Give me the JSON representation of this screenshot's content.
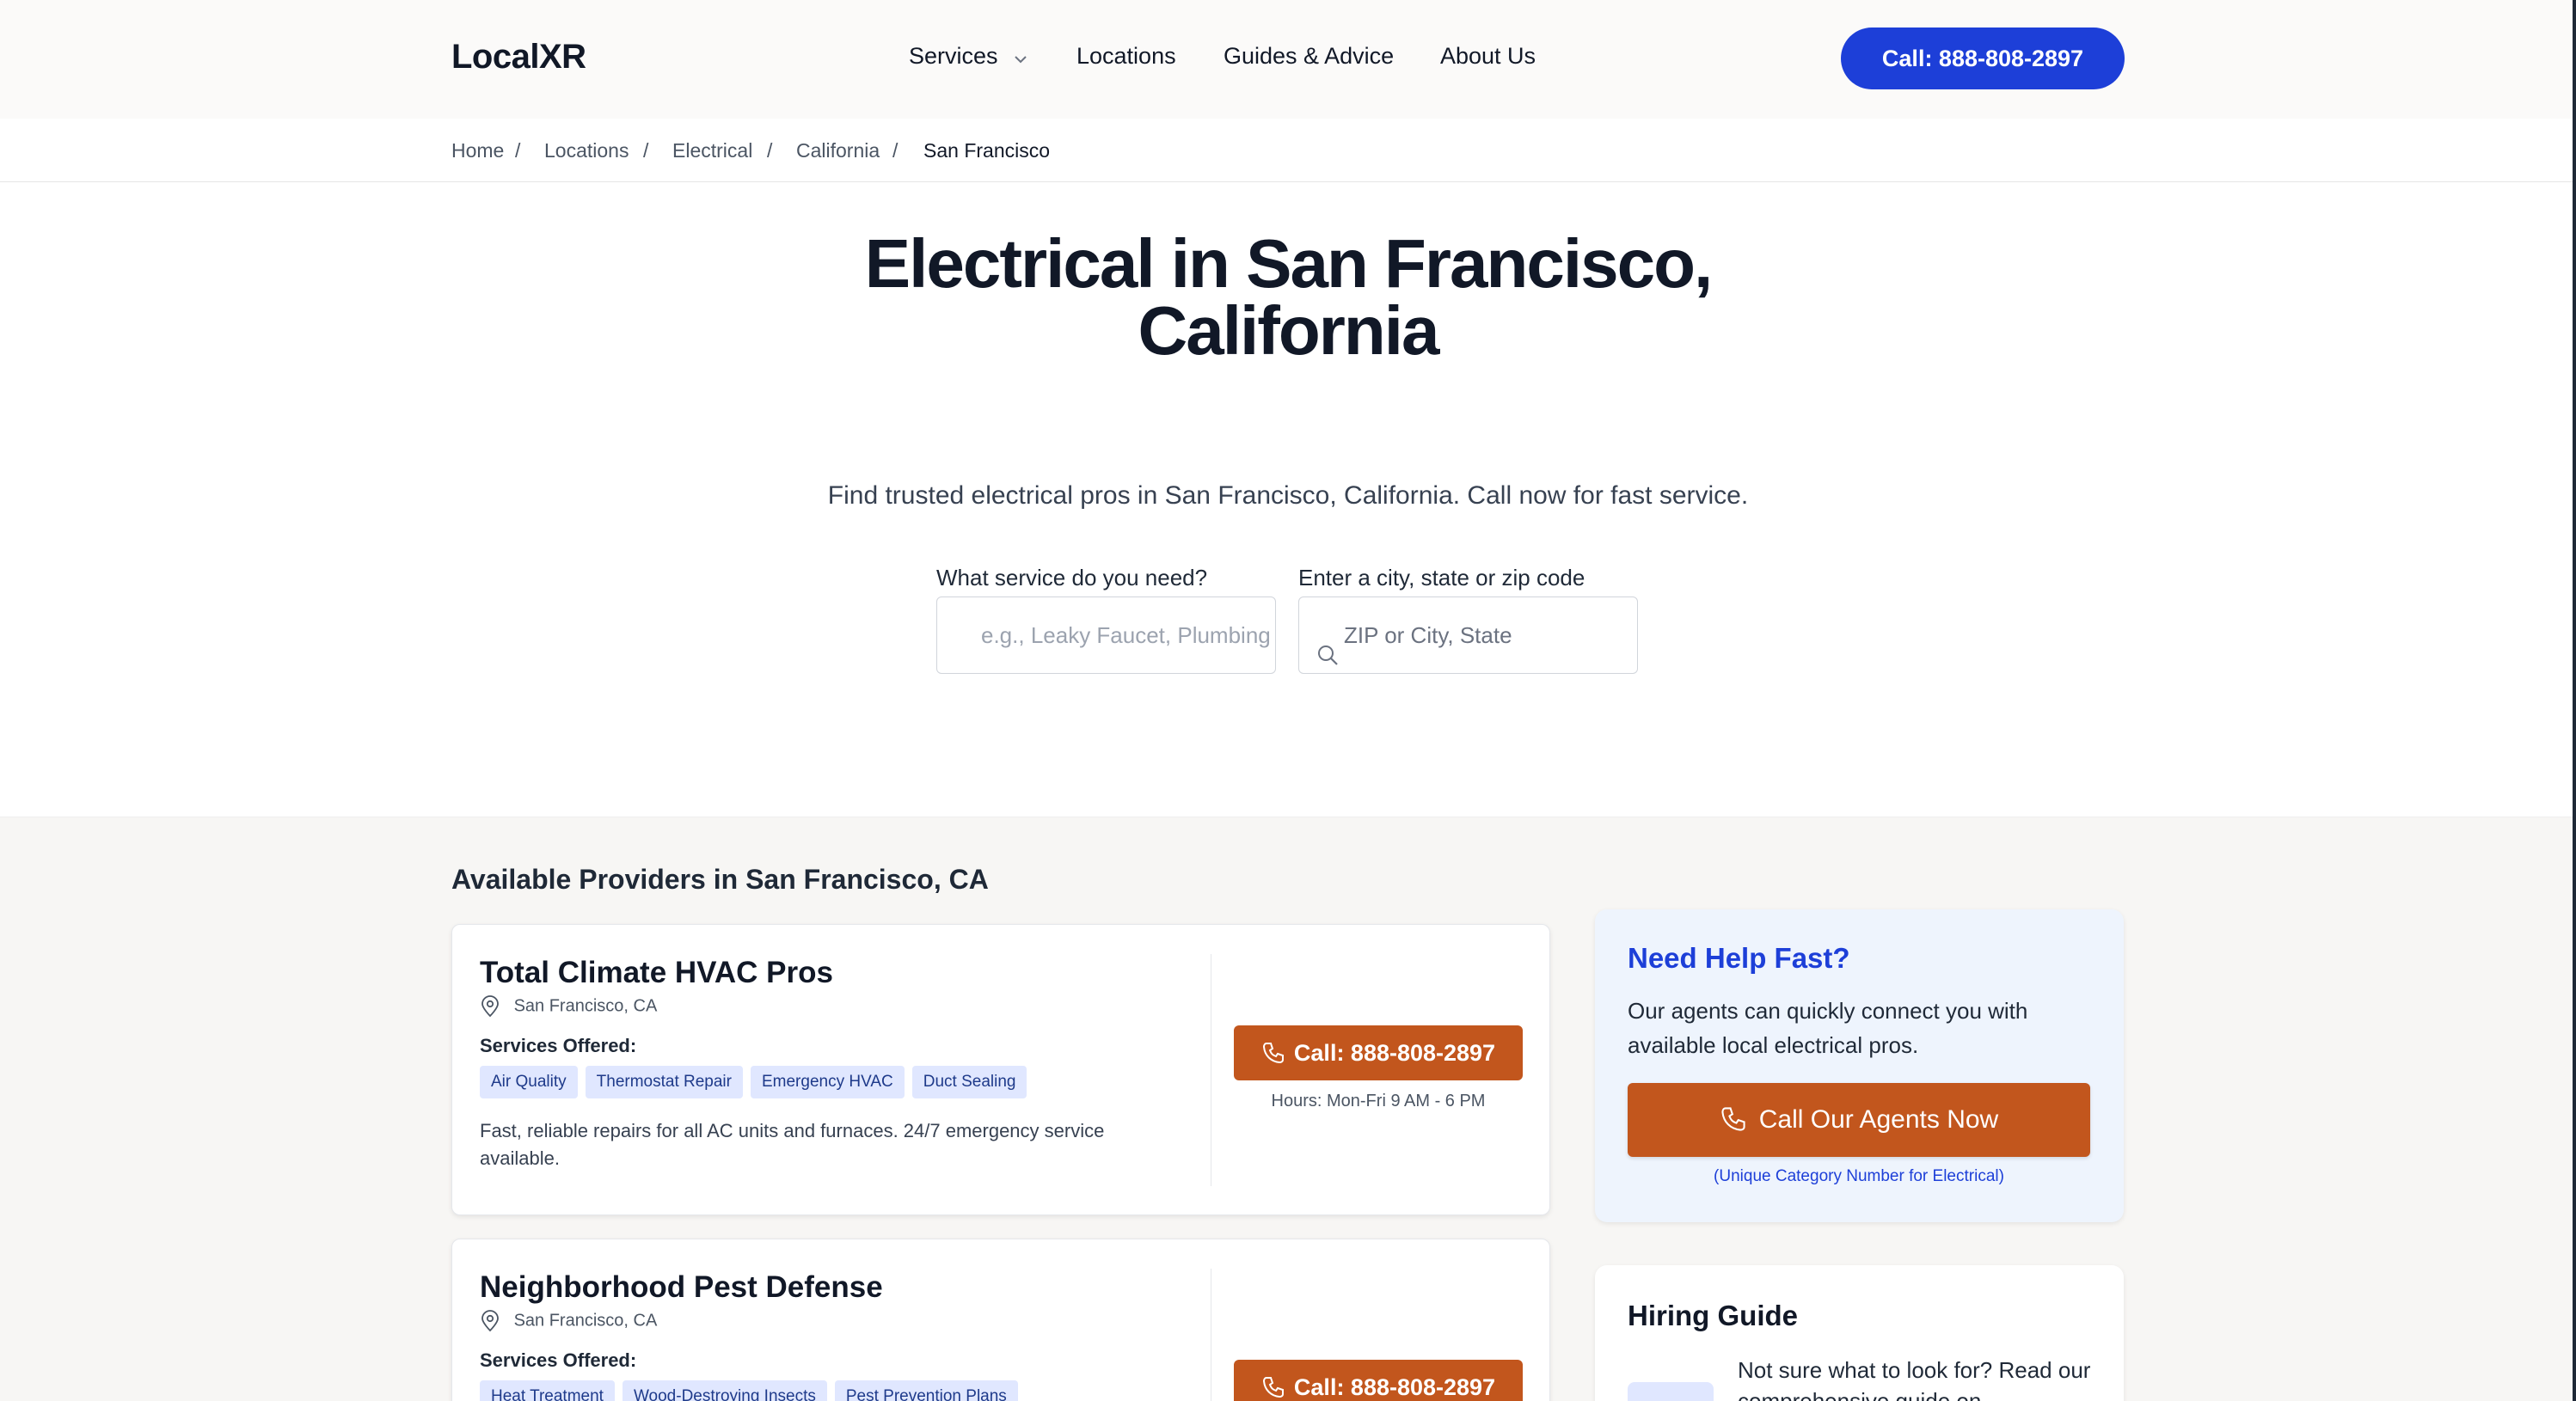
{
  "header": {
    "logo": "LocalXR",
    "nav": [
      {
        "label": "Services",
        "has_dropdown": true
      },
      {
        "label": "Locations"
      },
      {
        "label": "Guides & Advice"
      },
      {
        "label": "About Us"
      }
    ],
    "call_label": "Call: 888-808-2897"
  },
  "breadcrumb": {
    "items": [
      "Home",
      "Locations",
      "Electrical",
      "California"
    ],
    "separator": "/",
    "current": "San Francisco"
  },
  "hero": {
    "title_line1": "Electrical in San Francisco,",
    "title_line2": "California",
    "subtitle": "Find trusted electrical pros in San Francisco, California. Call now for fast service.",
    "service_label": "What service do you need?",
    "service_placeholder": "e.g., Leaky Faucet, Plumbing",
    "location_label": "Enter a city, state or zip code",
    "location_placeholder": "ZIP or City, State"
  },
  "providers": {
    "title": "Available Providers in San Francisco, CA",
    "services_offered_label": "Services Offered:",
    "items": [
      {
        "name": "Total Climate HVAC Pros",
        "location": "San Francisco, CA",
        "tags": [
          "Air Quality",
          "Thermostat Repair",
          "Emergency HVAC",
          "Duct Sealing"
        ],
        "description": "Fast, reliable repairs for all AC units and furnaces. 24/7 emergency service available.",
        "call_label": "Call: 888-808-2897",
        "hours": "Hours: Mon-Fri 9 AM - 6 PM"
      },
      {
        "name": "Neighborhood Pest Defense",
        "location": "San Francisco, CA",
        "tags": [
          "Heat Treatment",
          "Wood-Destroying Insects",
          "Pest Prevention Plans"
        ],
        "call_label": "Call: 888-808-2897"
      }
    ]
  },
  "sidebar": {
    "help": {
      "title": "Need Help Fast?",
      "text": "Our agents can quickly connect you with available local electrical pros.",
      "button_label": "Call Our Agents Now",
      "note": "(Unique Category Number for Electrical)"
    },
    "guide": {
      "title": "Hiring Guide",
      "text": "Not sure what to look for? Read our comprehensive guide on"
    }
  },
  "colors": {
    "brand_blue": "#1d3fd8",
    "call_orange": "#c2561d",
    "tag_bg": "#e0e7ff"
  }
}
